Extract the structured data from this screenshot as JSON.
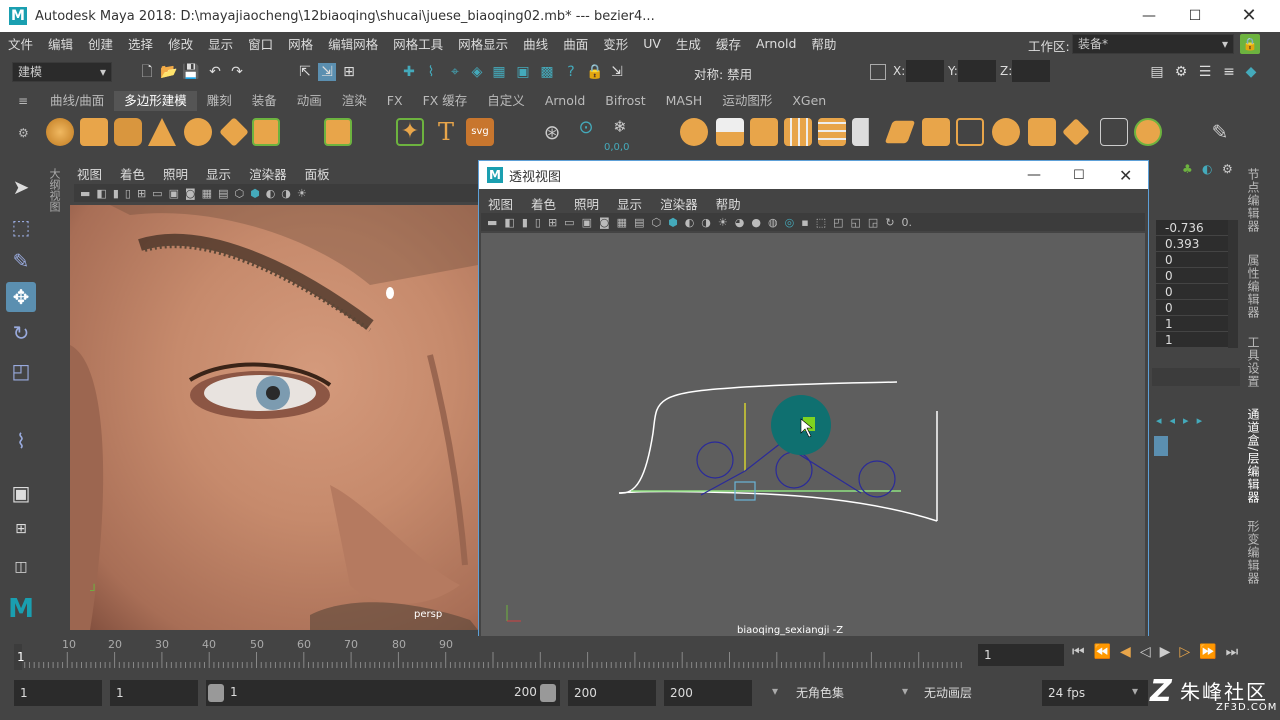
{
  "app": {
    "title": "Autodesk Maya 2018: D:\\mayajiaocheng\\12biaoqing\\shucai\\juese_biaoqing02.mb*   ---   bezier4...",
    "logo": "M"
  },
  "menu": [
    "文件",
    "编辑",
    "创建",
    "选择",
    "修改",
    "显示",
    "窗口",
    "网格",
    "编辑网格",
    "网格工具",
    "网格显示",
    "曲线",
    "曲面",
    "变形",
    "UV",
    "生成",
    "缓存",
    "Arnold",
    "帮助"
  ],
  "workspace": {
    "label": "工作区:",
    "value": "装备*"
  },
  "status_line": {
    "mode": "建模",
    "symmetry_label": "对称: 禁用",
    "x_label": "X:",
    "y_label": "Y:",
    "z_label": "Z:"
  },
  "shelf_tabs": [
    "曲线/曲面",
    "多边形建模",
    "雕刻",
    "装备",
    "动画",
    "渲染",
    "FX",
    "FX 缓存",
    "自定义",
    "Arnold",
    "Bifrost",
    "MASH",
    "运动图形",
    "XGen"
  ],
  "shelf_active": "多边形建模",
  "shelf_extra_label": "0,0,0",
  "main_panel": {
    "menu": [
      "视图",
      "着色",
      "照明",
      "显示",
      "渲染器",
      "面板"
    ],
    "camera_label": "persp",
    "side_label": "大纲视图"
  },
  "float_window": {
    "title": "透视视图",
    "menu": [
      "视图",
      "着色",
      "照明",
      "显示",
      "渲染器",
      "帮助"
    ],
    "camera_label": "biaoqing_sexiangji -Z",
    "toolbar_tail": "0."
  },
  "channel_box": {
    "values": [
      "-0.736",
      "0.393",
      "0",
      "0",
      "0",
      "0",
      "1",
      "1"
    ]
  },
  "right_tabs": [
    "节点编辑器",
    "属性编辑器",
    "工具设置",
    "通道盒/层编辑器",
    "形变编辑器"
  ],
  "timeline": {
    "ticks": [
      "10",
      "20",
      "30",
      "40",
      "50",
      "60",
      "70",
      "80",
      "90"
    ],
    "current_frame": "1",
    "frame_field": "1"
  },
  "range": {
    "start": "1",
    "playback_start": "1",
    "slider_start": "1",
    "slider_end": "200",
    "playback_end": "200",
    "end": "200",
    "character_set": "无角色集",
    "anim_layer": "无动画层",
    "fps": "24 fps"
  },
  "watermark": {
    "brand": "朱峰社区",
    "url": "ZF3D.COM"
  },
  "colors": {
    "accent": "#1a9fb0",
    "selection": "#5da0d8",
    "shelf_orange": "#e8a54a"
  }
}
